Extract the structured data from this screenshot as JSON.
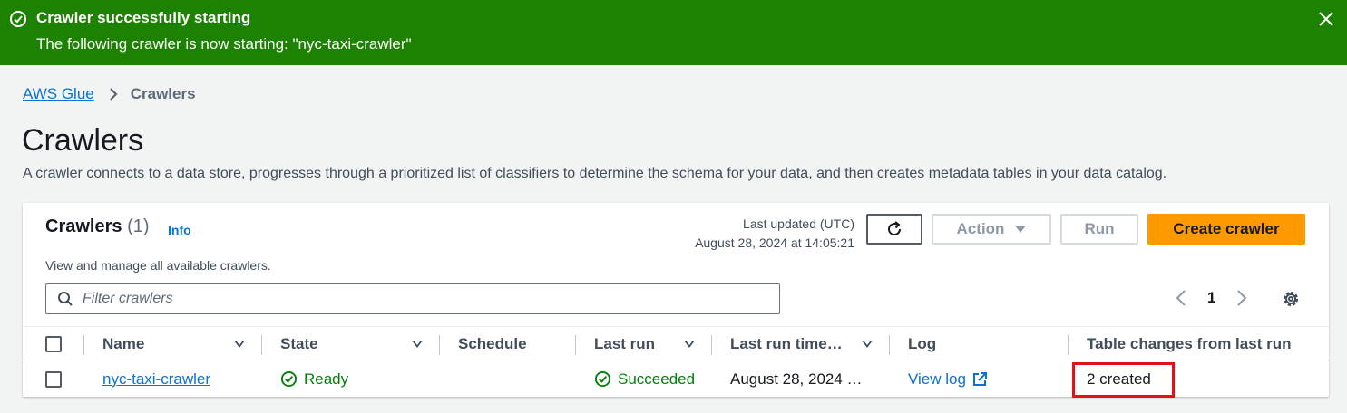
{
  "flash": {
    "title": "Crawler successfully starting",
    "message": "The following crawler is now starting: \"nyc-taxi-crawler\"",
    "color": "#1d8102"
  },
  "breadcrumb": {
    "root": "AWS Glue",
    "current": "Crawlers"
  },
  "page": {
    "title": "Crawlers",
    "description": "A crawler connects to a data store, progresses through a prioritized list of classifiers to determine the schema for your data, and then creates metadata tables in your data catalog."
  },
  "panel": {
    "title": "Crawlers",
    "count": "(1)",
    "info": "Info",
    "subtitle": "View and manage all available crawlers.",
    "last_updated_label": "Last updated (UTC)",
    "last_updated_value": "August 28, 2024 at 14:05:21",
    "buttons": {
      "action": "Action",
      "run": "Run",
      "create": "Create crawler"
    },
    "filter_placeholder": "Filter crawlers",
    "page_number": "1"
  },
  "table": {
    "columns": [
      "Name",
      "State",
      "Schedule",
      "Last run",
      "Last run time…",
      "Log",
      "Table changes from last run"
    ],
    "rows": [
      {
        "name": "nyc-taxi-crawler",
        "state": "Ready",
        "schedule": "",
        "last_run": "Succeeded",
        "last_run_time": "August 28, 2024 …",
        "log": "View log",
        "table_changes": "2 created"
      }
    ]
  },
  "colors": {
    "accent": "#ff9900",
    "link": "#0972d3",
    "success": "#037f0c",
    "highlight": "#e3101c"
  }
}
